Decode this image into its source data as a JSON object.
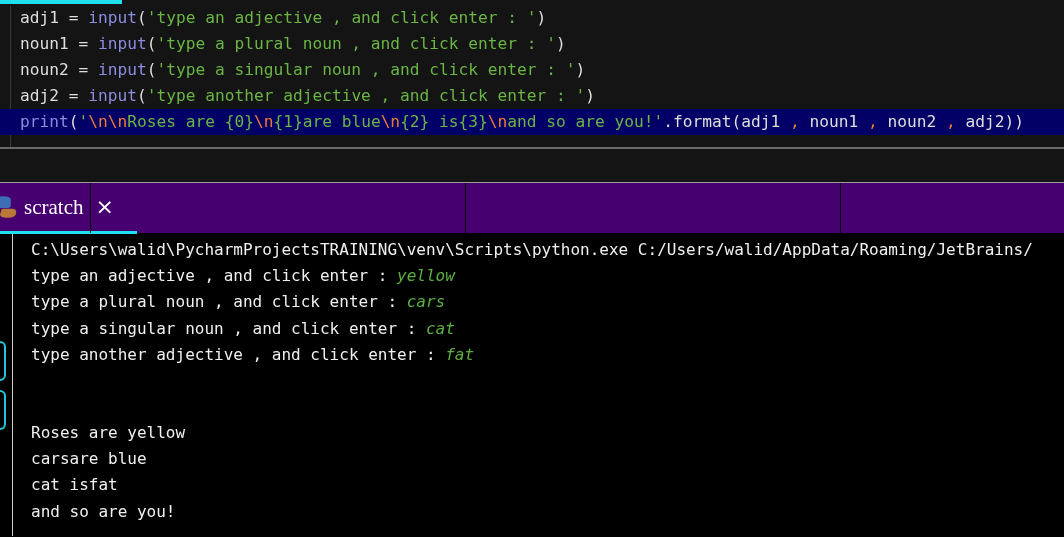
{
  "editor": {
    "lines": [
      {
        "selected": false,
        "tokens": [
          {
            "text": "adj1 = ",
            "kind": "plain"
          },
          {
            "text": "input",
            "kind": "builtin"
          },
          {
            "text": "(",
            "kind": "plain"
          },
          {
            "text": "'type an adjective , and click enter : '",
            "kind": "string"
          },
          {
            "text": ")",
            "kind": "plain"
          }
        ]
      },
      {
        "selected": false,
        "tokens": [
          {
            "text": "noun1 = ",
            "kind": "plain"
          },
          {
            "text": "input",
            "kind": "builtin"
          },
          {
            "text": "(",
            "kind": "plain"
          },
          {
            "text": "'type a plural noun , and click enter : '",
            "kind": "string"
          },
          {
            "text": ")",
            "kind": "plain"
          }
        ]
      },
      {
        "selected": false,
        "tokens": [
          {
            "text": "noun2 = ",
            "kind": "plain"
          },
          {
            "text": "input",
            "kind": "builtin"
          },
          {
            "text": "(",
            "kind": "plain"
          },
          {
            "text": "'type a singular noun , and click enter : '",
            "kind": "string"
          },
          {
            "text": ")",
            "kind": "plain"
          }
        ]
      },
      {
        "selected": false,
        "tokens": [
          {
            "text": "adj2 = ",
            "kind": "plain"
          },
          {
            "text": "input",
            "kind": "builtin"
          },
          {
            "text": "(",
            "kind": "plain"
          },
          {
            "text": "'type another adjective , and click enter : '",
            "kind": "string"
          },
          {
            "text": ")",
            "kind": "plain"
          }
        ]
      },
      {
        "selected": true,
        "tokens": [
          {
            "text": "print",
            "kind": "builtin"
          },
          {
            "text": "(",
            "kind": "plain"
          },
          {
            "text": "'",
            "kind": "string"
          },
          {
            "text": "\\n\\n",
            "kind": "escape"
          },
          {
            "text": "Roses are {0}",
            "kind": "string"
          },
          {
            "text": "\\n",
            "kind": "escape"
          },
          {
            "text": "{1}are blue",
            "kind": "string"
          },
          {
            "text": "\\n",
            "kind": "escape"
          },
          {
            "text": "{2} is{3}",
            "kind": "string"
          },
          {
            "text": "\\n",
            "kind": "escape"
          },
          {
            "text": "and so are you!'",
            "kind": "string"
          },
          {
            "text": ".format(adj1 ",
            "kind": "plain"
          },
          {
            "text": ",",
            "kind": "punct"
          },
          {
            "text": " noun1 ",
            "kind": "plain"
          },
          {
            "text": ",",
            "kind": "punct"
          },
          {
            "text": " noun2 ",
            "kind": "plain"
          },
          {
            "text": ",",
            "kind": "punct"
          },
          {
            "text": " adj2))",
            "kind": "plain"
          }
        ]
      }
    ]
  },
  "run_tabs": [
    {
      "label": "scratch",
      "close": "×",
      "selected": true
    }
  ],
  "console": {
    "command": "C:\\Users\\walid\\PycharmProjectsTRAINING\\venv\\Scripts\\python.exe C:/Users/walid/AppData/Roaming/JetBrains/",
    "prompts": [
      {
        "prompt": "type an adjective , and click enter : ",
        "answer": "yellow"
      },
      {
        "prompt": "type a plural noun , and click enter : ",
        "answer": "cars"
      },
      {
        "prompt": "type a singular noun , and click enter : ",
        "answer": "cat"
      },
      {
        "prompt": "type another adjective , and click enter : ",
        "answer": "fat"
      }
    ],
    "output": [
      "Roses are yellow",
      "carsare blue",
      "cat isfat",
      "and so are you!"
    ]
  }
}
